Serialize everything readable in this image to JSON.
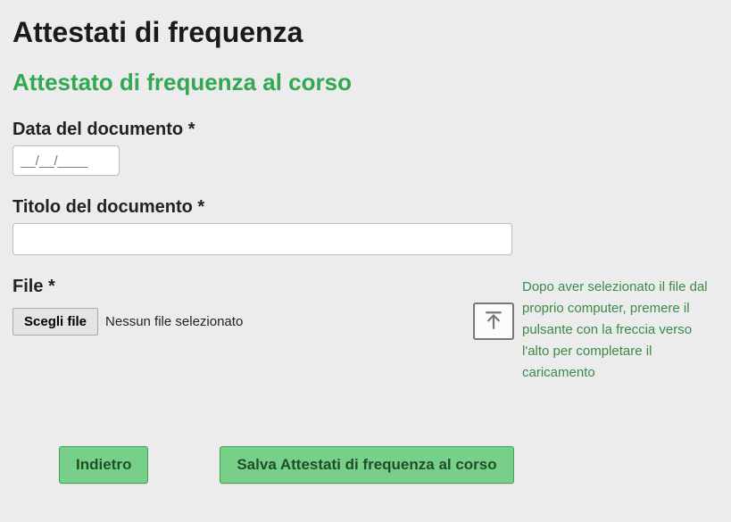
{
  "page_title": "Attestati di frequenza",
  "subtitle": "Attestato di frequenza al corso",
  "fields": {
    "date": {
      "label": "Data del documento *",
      "placeholder": "__/__/____"
    },
    "title": {
      "label": "Titolo del documento *",
      "value": ""
    },
    "file": {
      "label": "File *",
      "choose_button": "Scegli file",
      "status": "Nessun file selezionato"
    }
  },
  "hint": "Dopo aver selezionato il file dal proprio computer, premere il pulsante con la freccia verso l'alto per completare il caricamento",
  "buttons": {
    "back": "Indietro",
    "save": "Salva Attestati di frequenza al corso"
  }
}
